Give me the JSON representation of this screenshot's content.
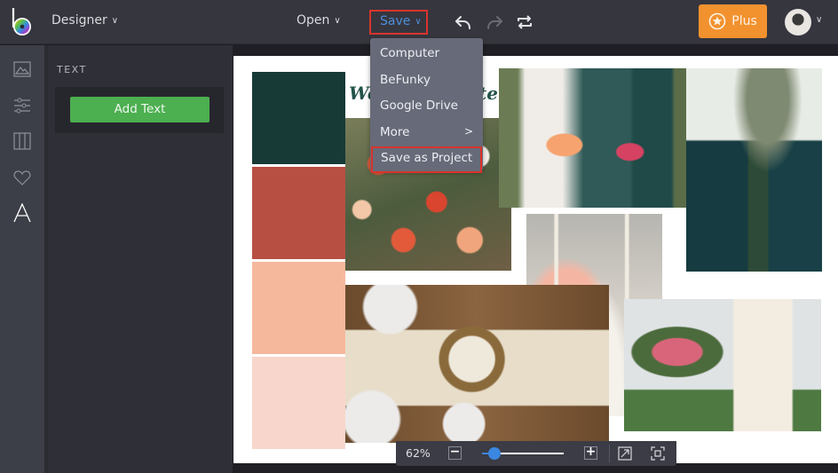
{
  "topbar": {
    "app_mode": "Designer",
    "open_label": "Open",
    "save_label": "Save",
    "plus_label": "Plus",
    "icons": {
      "logo": "befunky-logo",
      "undo": "undo-icon",
      "redo": "redo-icon",
      "swap": "swap-icon",
      "star": "star-icon"
    }
  },
  "colors": {
    "accent_blue": "#4d8fd8",
    "highlight_red": "#d9342b",
    "plus_orange": "#f2922f",
    "add_text_green": "#4caf50",
    "menu_bg": "#676a78"
  },
  "rail": {
    "items": [
      {
        "name": "image-manager",
        "icon": "image-icon"
      },
      {
        "name": "customize",
        "icon": "sliders-icon"
      },
      {
        "name": "layouts",
        "icon": "columns-icon"
      },
      {
        "name": "graphics",
        "icon": "heart-icon"
      },
      {
        "name": "text",
        "icon": "text-icon",
        "active": true
      }
    ]
  },
  "panel": {
    "title": "TEXT",
    "add_text_label": "Add Text"
  },
  "save_menu": {
    "items": [
      {
        "label": "Computer"
      },
      {
        "label": "BeFunky"
      },
      {
        "label": "Google Drive"
      },
      {
        "label": "More",
        "submenu": true
      },
      {
        "label": "Save as Project",
        "highlighted": true
      }
    ]
  },
  "canvas": {
    "title_fragment_left": "We",
    "title_fragment_right": "te",
    "swatches": [
      "#173a37",
      "#b84f43",
      "#f5b89d",
      "#f8d6cc"
    ],
    "photos": [
      {
        "subject": "dahlia-field"
      },
      {
        "subject": "bride-and-bridesmaid"
      },
      {
        "subject": "bridesmaids-under-tree"
      },
      {
        "subject": "candle-centerpiece"
      },
      {
        "subject": "table-setting-with-cake"
      },
      {
        "subject": "ceremony-arch"
      }
    ]
  },
  "zoombar": {
    "zoom_percent": "62%",
    "slider_fraction": 0.15,
    "minus_label": "−",
    "plus_label": "+"
  }
}
